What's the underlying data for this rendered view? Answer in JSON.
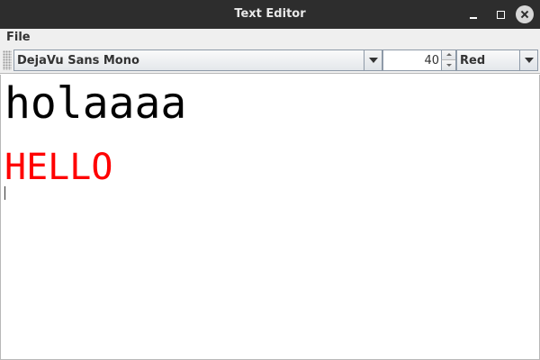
{
  "window": {
    "title": "Text Editor"
  },
  "menubar": {
    "items": [
      {
        "label": "File"
      }
    ]
  },
  "toolbar": {
    "font_select": {
      "value": "DejaVu Sans Mono"
    },
    "size_spinner": {
      "value": "40"
    },
    "color_select": {
      "value": "Red"
    }
  },
  "editor": {
    "lines": [
      {
        "text": "holaaaa",
        "color": "#000000"
      },
      {
        "text": "HELLO",
        "color": "#ff0000"
      }
    ]
  },
  "colors": {
    "titlebar": "#2d2d2d",
    "text_red": "#ff0000",
    "text_black": "#000000"
  }
}
